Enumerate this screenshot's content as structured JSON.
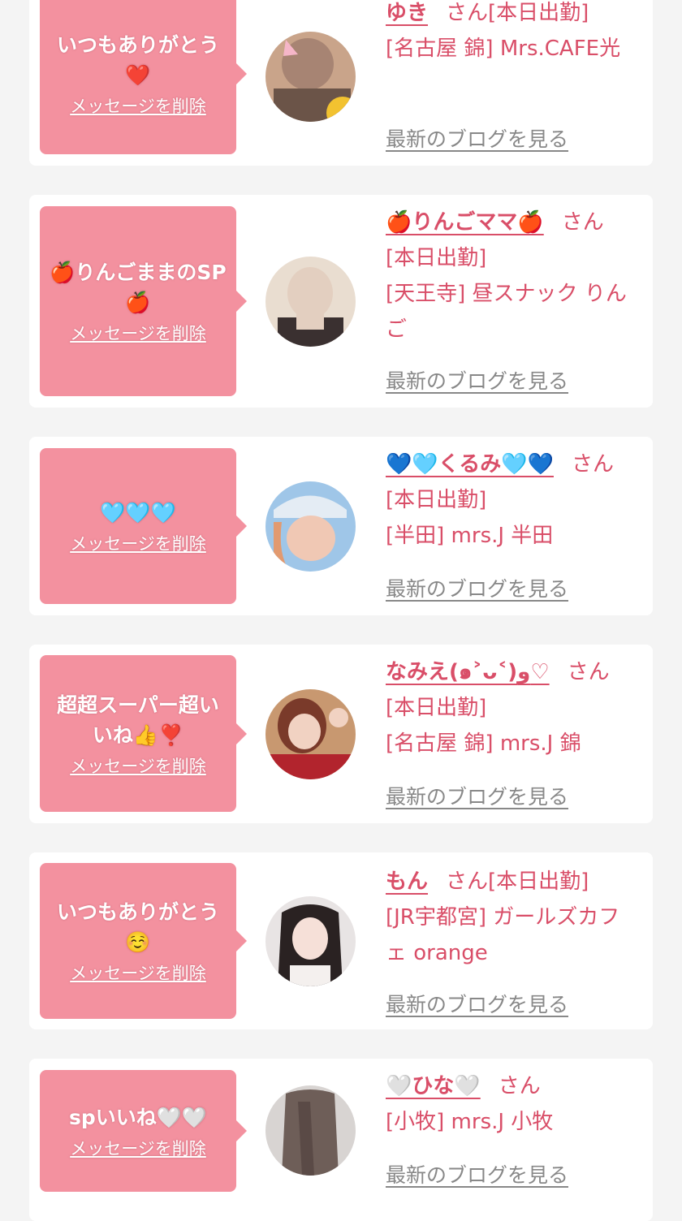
{
  "cards": [
    {
      "message": "いつもありがとう❤️",
      "delete_label": "メッセージを削除",
      "name": "ゆき",
      "honorific": "さん",
      "status": "[本日出勤]",
      "shop": "[名古屋 錦] Mrs.CAFE光",
      "blog_label": "最新のブログを見る",
      "avatar_colors": [
        "#c9a48a",
        "#6b5448"
      ]
    },
    {
      "message": "🍎りんごままのSP🍎",
      "delete_label": "メッセージを削除",
      "name": "🍎りんごママ🍎",
      "honorific": "さん",
      "status": "[本日出勤]",
      "shop": "[天王寺] 昼スナック りんご",
      "blog_label": "最新のブログを見る",
      "avatar_colors": [
        "#e3cfc0",
        "#3a3030"
      ]
    },
    {
      "message": "🩵🩵🩵",
      "delete_label": "メッセージを削除",
      "name": "💙🩵くるみ🩵💙",
      "honorific": "さん",
      "status": "[本日出勤]",
      "shop": "[半田] mrs.J 半田",
      "blog_label": "最新のブログを見る",
      "avatar_colors": [
        "#9fc6e8",
        "#f0c8b4"
      ]
    },
    {
      "message": "超超スーパー超いいね👍❣️",
      "delete_label": "メッセージを削除",
      "name": "なみえ(๑˃ᴗ˂)ﻭ♡",
      "honorific": "さん",
      "status": "[本日出勤]",
      "shop": "[名古屋 錦] mrs.J 錦",
      "blog_label": "最新のブログを見る",
      "avatar_colors": [
        "#7a3a2a",
        "#b2242d"
      ]
    },
    {
      "message": "いつもありがとう☺️",
      "delete_label": "メッセージを削除",
      "name": "もん",
      "honorific": "さん",
      "status": "[本日出勤]",
      "shop": "[JR宇都宮] ガールズカフェ orange",
      "blog_label": "最新のブログを見る",
      "avatar_colors": [
        "#e8e4e4",
        "#2a2222"
      ]
    },
    {
      "message": "spいいね🤍🤍",
      "delete_label": "メッセージを削除",
      "name": "🤍ひな🤍",
      "honorific": "さん",
      "status": "",
      "shop": "[小牧] mrs.J 小牧",
      "blog_label": "最新のブログを見る",
      "avatar_colors": [
        "#d8d4d2",
        "#6e5e58"
      ]
    }
  ]
}
